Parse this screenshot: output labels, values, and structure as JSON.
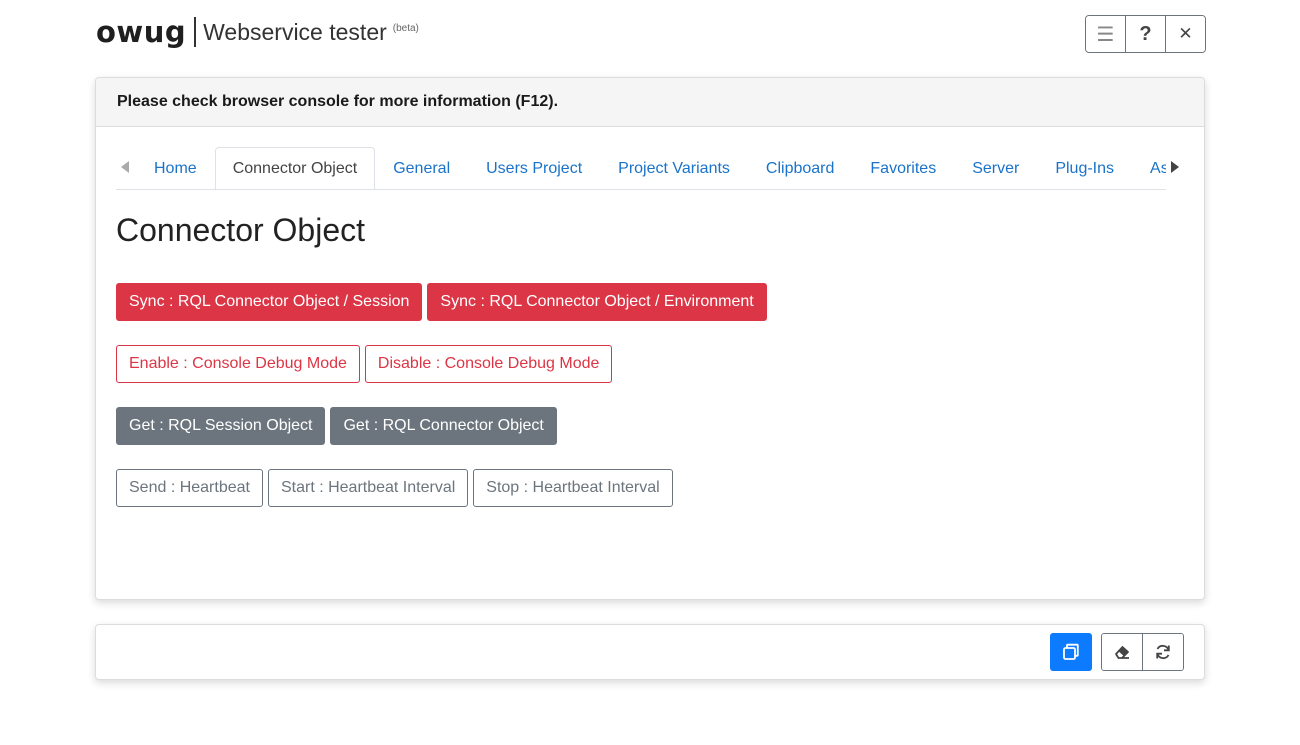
{
  "header": {
    "logo": "owug",
    "title": "Webservice tester",
    "badge": "(beta)",
    "buttons": [
      {
        "icon": "menu-icon",
        "glyph": "☰"
      },
      {
        "icon": "help-icon",
        "glyph": "?"
      },
      {
        "icon": "close-icon",
        "glyph": "✕"
      }
    ]
  },
  "card": {
    "notice": "Please check browser console for more information (F12).",
    "tabs": [
      {
        "label": "Home",
        "active": false
      },
      {
        "label": "Connector Object",
        "active": true
      },
      {
        "label": "General",
        "active": false
      },
      {
        "label": "Users Project",
        "active": false
      },
      {
        "label": "Project Variants",
        "active": false
      },
      {
        "label": "Clipboard",
        "active": false
      },
      {
        "label": "Favorites",
        "active": false
      },
      {
        "label": "Server",
        "active": false
      },
      {
        "label": "Plug-Ins",
        "active": false
      },
      {
        "label": "Asynchronous",
        "active": false
      }
    ],
    "page_title": "Connector Object",
    "rows": [
      [
        "Sync : RQL Connector Object / Session",
        "Sync : RQL Connector Object / Environment"
      ],
      [
        "Enable : Console Debug Mode",
        "Disable : Console Debug Mode"
      ],
      [
        "Get : RQL Session Object",
        "Get : RQL Connector Object"
      ],
      [
        "Send : Heartbeat",
        "Start : Heartbeat Interval",
        "Stop : Heartbeat Interval"
      ]
    ]
  },
  "footer": {
    "buttons": [
      {
        "icon": "copy-icon"
      },
      {
        "icon": "eraser-icon"
      },
      {
        "icon": "refresh-icon"
      }
    ]
  },
  "colors": {
    "danger": "#dc3545",
    "secondary": "#6c757d",
    "primary": "#0d7bff",
    "link": "#1a73c9"
  }
}
